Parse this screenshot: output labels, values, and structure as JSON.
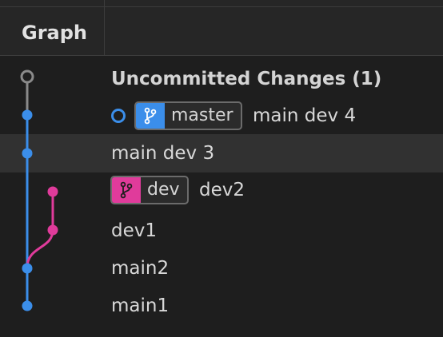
{
  "header": {
    "graph_label": "Graph"
  },
  "rows": [
    {
      "text": "Uncommitted Changes (1)",
      "bold": true
    },
    {
      "text": "main dev 4",
      "branch": "master",
      "head": true
    },
    {
      "text": "main dev 3",
      "selected": true
    },
    {
      "text": "dev2",
      "branch": "dev"
    },
    {
      "text": "dev1"
    },
    {
      "text": "main2"
    },
    {
      "text": "main1"
    }
  ],
  "colors": {
    "background": "#1e1e1e",
    "header_background": "#262626",
    "selected_row": "#313131",
    "master_branch": "#3b8eea",
    "dev_branch": "#e03b9b",
    "uncommitted": "#8a8a8a"
  },
  "icons": {
    "branch": "git-branch-icon",
    "head": "head-circle-icon"
  }
}
